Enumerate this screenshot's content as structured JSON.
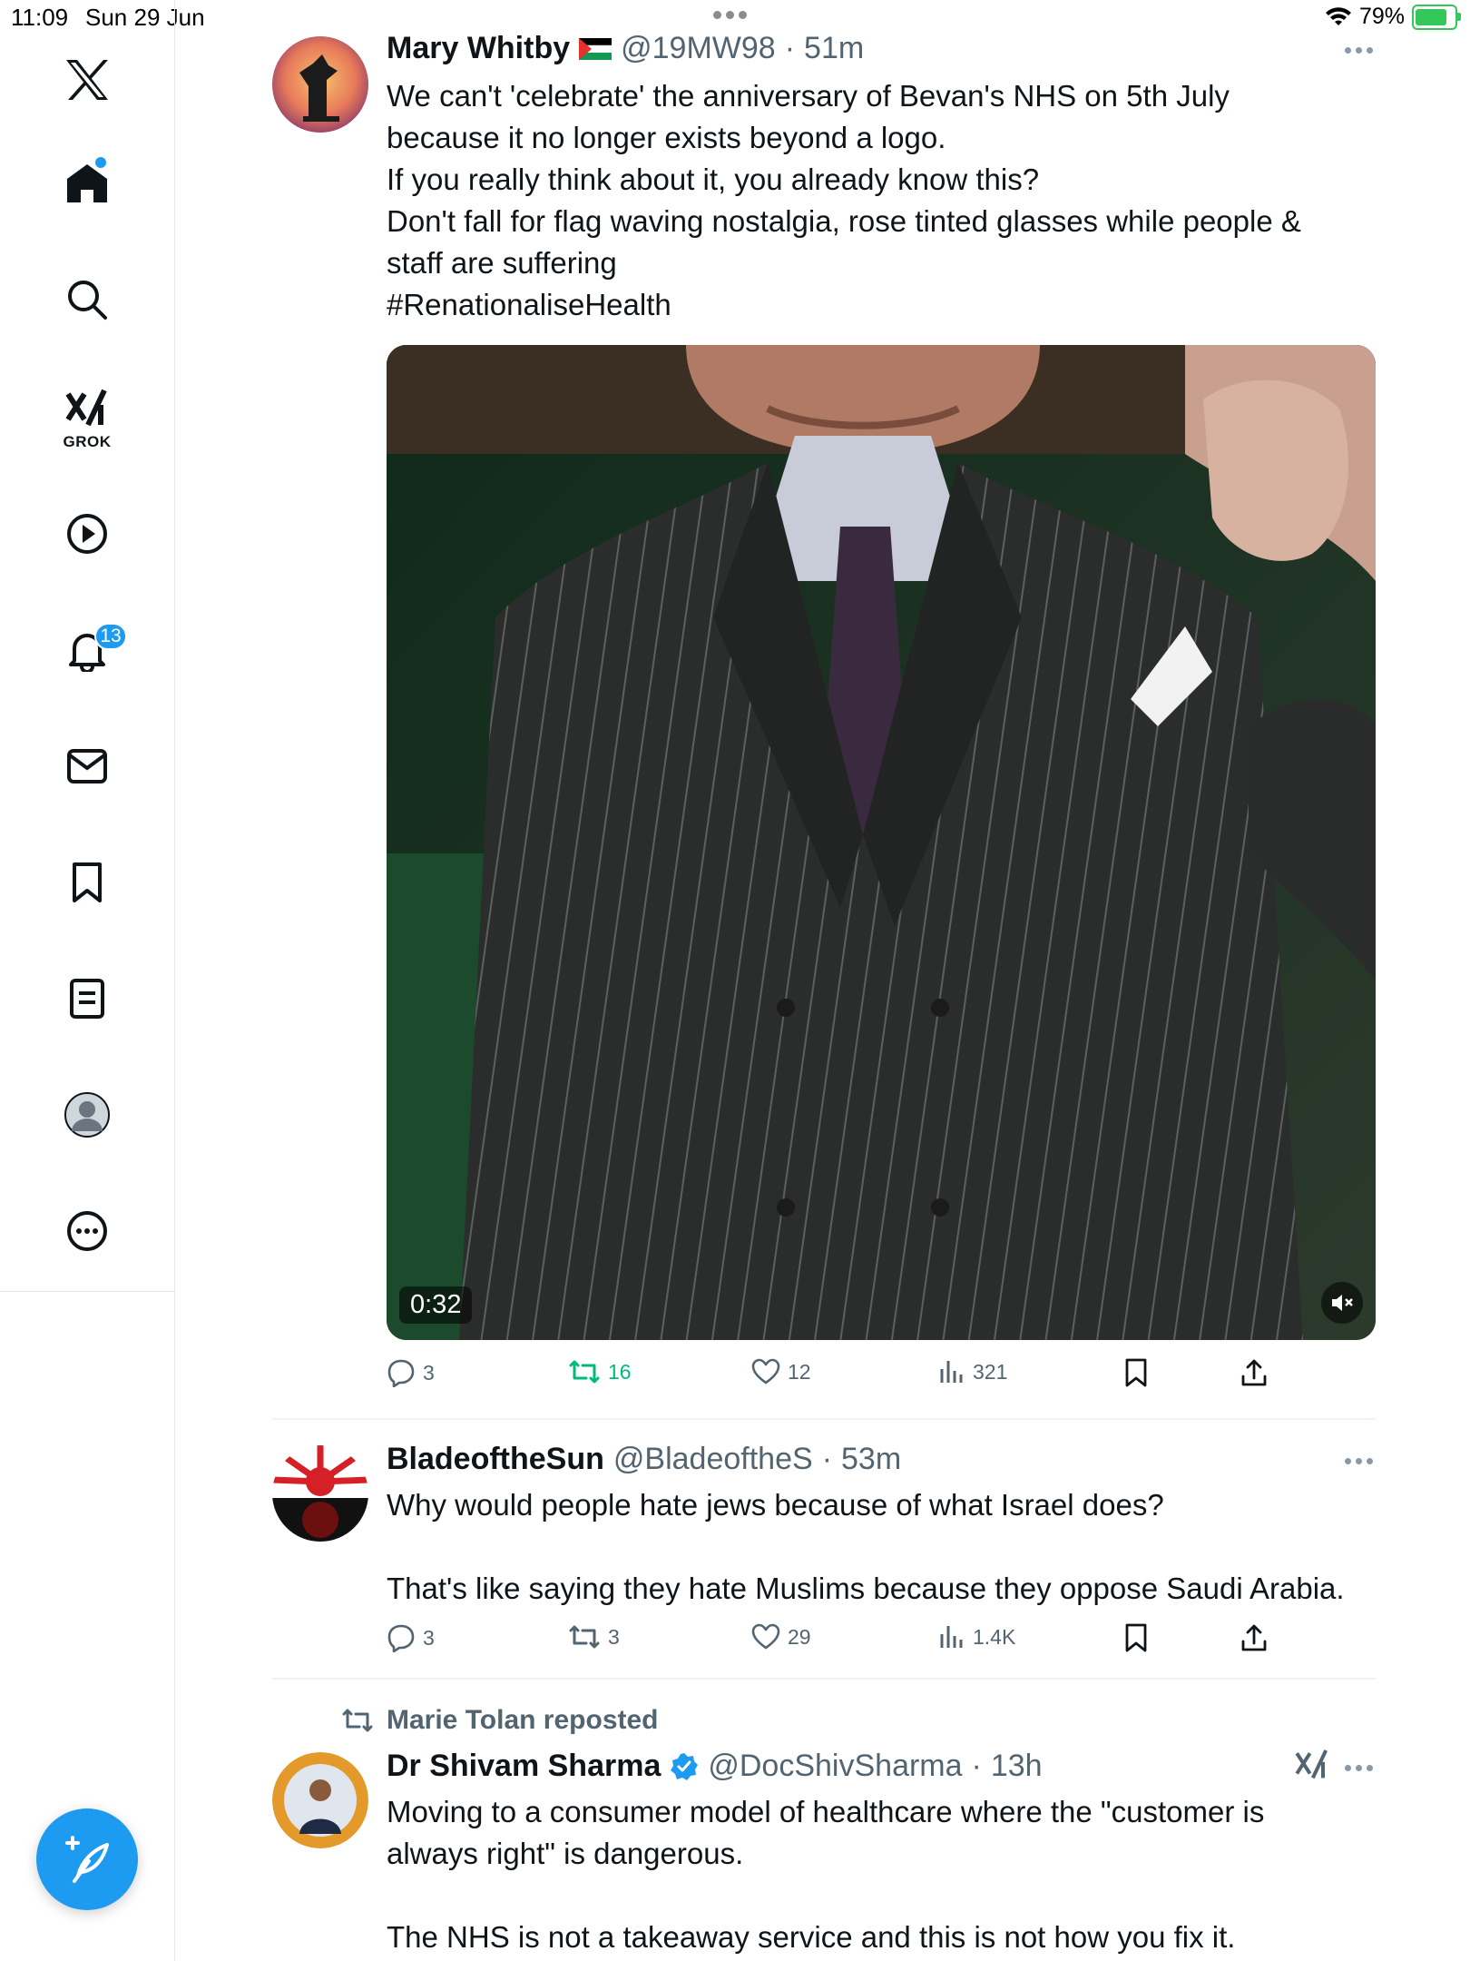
{
  "status_bar": {
    "time": "11:09",
    "date": "Sun 29 Jun",
    "battery": "79%"
  },
  "sidebar": {
    "items": [
      {
        "name": "x-logo-icon"
      },
      {
        "name": "home-icon"
      },
      {
        "name": "search-icon"
      },
      {
        "name": "grok-icon",
        "label": "GROK"
      },
      {
        "name": "video-icon"
      },
      {
        "name": "notifications-icon",
        "badge": "13"
      },
      {
        "name": "messages-icon"
      },
      {
        "name": "bookmarks-icon"
      },
      {
        "name": "lists-icon"
      },
      {
        "name": "profile-icon"
      },
      {
        "name": "more-icon"
      }
    ]
  },
  "tweets": [
    {
      "name": "Mary Whitby",
      "handle": "@19MW98",
      "dot": "·",
      "time": "51m",
      "text": "We can't 'celebrate' the anniversary of Bevan's NHS on 5th July\nbecause it no longer exists beyond a logo.\nIf you really think about it, you already know this?\nDon't fall for flag waving nostalgia, rose tinted glasses while people &\nstaff are suffering\n#RenationaliseHealth",
      "video_duration": "0:32",
      "stats": {
        "replies": "3",
        "reposts": "16",
        "likes": "12",
        "views": "321"
      }
    },
    {
      "name": "BladeoftheSun",
      "handle": "@BladeoftheS",
      "dot": "·",
      "time": "53m",
      "text": "Why would people hate jews because of what Israel does?\n\nThat's like saying they hate Muslims because they oppose Saudi Arabia.",
      "stats": {
        "replies": "3",
        "reposts": "3",
        "likes": "29",
        "views": "1.4K"
      }
    },
    {
      "reposted_by": "Marie Tolan reposted",
      "name": "Dr Shivam Sharma",
      "handle": "@DocShivSharma",
      "dot": "·",
      "time": "13h",
      "text": "Moving to a consumer model of healthcare where the \"customer is\nalways right\" is dangerous.\n\nThe NHS is not a takeaway service and this is not how you fix it."
    }
  ],
  "colors": {
    "accent": "#1d9bf0",
    "repost_active": "#00ba7c",
    "secondary_text": "#536471"
  }
}
